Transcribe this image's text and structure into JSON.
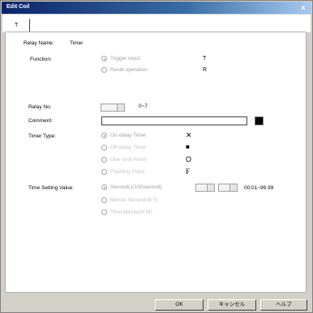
{
  "window": {
    "title": "Edit Coil",
    "close_glyph": "x"
  },
  "tabs": [
    {
      "label": "T"
    }
  ],
  "relay_name": {
    "label": "Relay Name:",
    "value": "Timer"
  },
  "function": {
    "label": "Function:",
    "options": [
      {
        "label": "Trigger input",
        "symbol": "T",
        "selected": true
      },
      {
        "label": "Reset operation",
        "symbol": "R",
        "selected": false
      }
    ]
  },
  "relay_no": {
    "label": "Relay No:",
    "range": "0~7"
  },
  "comment": {
    "label": "Comment:",
    "value": ""
  },
  "timer_type": {
    "label": "Timer Type:",
    "options": [
      {
        "label": "On-delay Timer",
        "symbol": "✕",
        "selected": true
      },
      {
        "label": "Off-delay Timer",
        "symbol": "■",
        "selected": false
      },
      {
        "label": "One-shot Pulse",
        "symbol": "O",
        "selected": false
      },
      {
        "label": "Flashing Pulse",
        "symbol": "F",
        "selected": false
      }
    ]
  },
  "time_setting": {
    "label": "Time Setting Value:",
    "options": [
      {
        "label": "Second(1/100second)",
        "selected": true
      },
      {
        "label": "Minute:Second(M:S)",
        "selected": false
      },
      {
        "label": "Time:Minute(H:M)",
        "selected": false
      }
    ],
    "range": "00.01~99.99"
  },
  "buttons": {
    "ok": "OK",
    "cancel": "キャンセル",
    "help": "ヘルプ"
  }
}
